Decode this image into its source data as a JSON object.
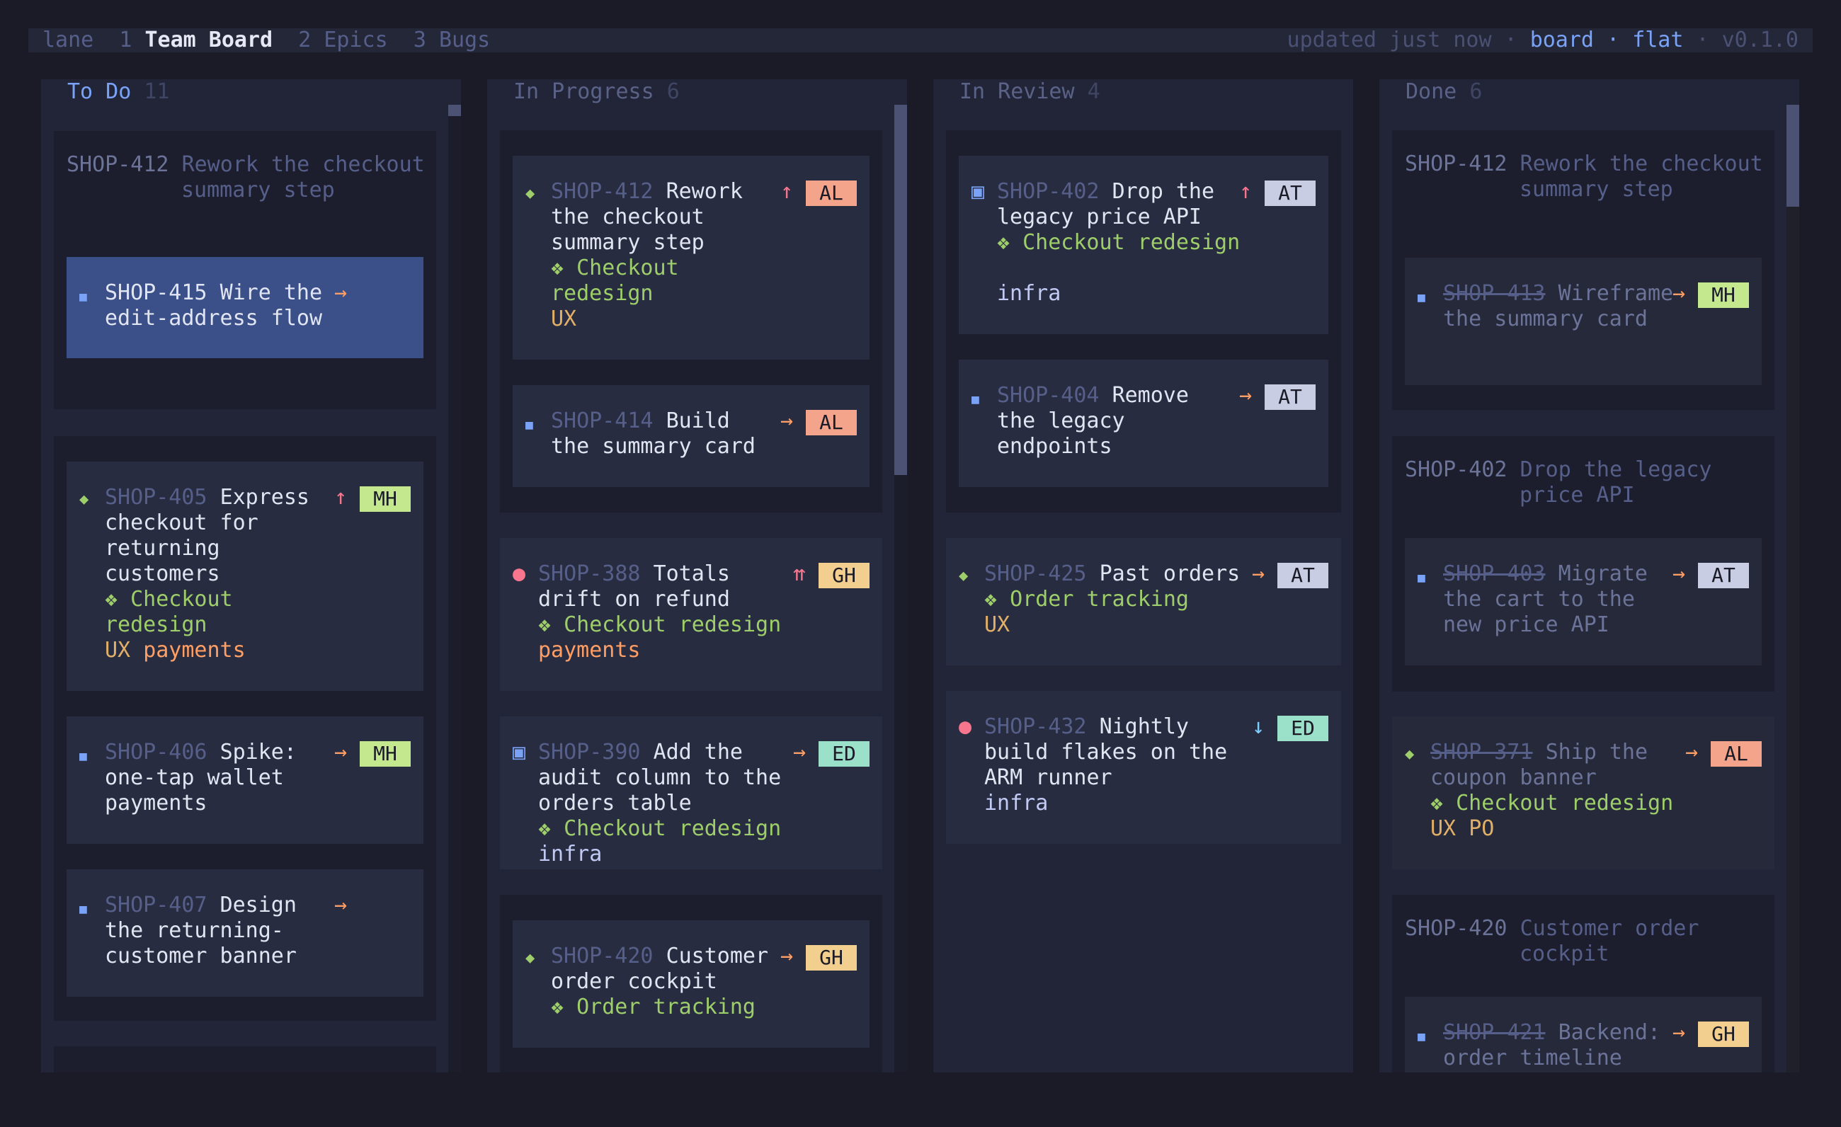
{
  "topbar": {
    "lane_label": "lane",
    "tabs": [
      {
        "num": "1",
        "label": "Team Board"
      },
      {
        "num": "2",
        "label": "Epics"
      },
      {
        "num": "3",
        "label": "Bugs"
      }
    ],
    "status": "updated just now",
    "sep": "·",
    "view": "board",
    "layout": "flat",
    "version": "v0.1.0"
  },
  "columns": {
    "todo": {
      "name": "To Do",
      "count": "11"
    },
    "inprogress": {
      "name": "In Progress",
      "count": "6"
    },
    "inreview": {
      "name": "In Review",
      "count": "4"
    },
    "done": {
      "name": "Done",
      "count": "6"
    }
  },
  "todo": {
    "group1": {
      "key": "SHOP-412",
      "line1": "Rework the checkout",
      "line2": "summary step"
    },
    "c415": {
      "key": "SHOP-415",
      "l1": "Wire the",
      "l2": "edit-address flow",
      "prio": "→"
    },
    "c405": {
      "key": "SHOP-405",
      "l1": "Express",
      "l2": "checkout for",
      "l3": "returning",
      "l4": "customers",
      "epic1": "❖ Checkout",
      "epic2": "redesign",
      "label1": "UX",
      "label2": "payments",
      "prio": "↑",
      "assignee": "MH"
    },
    "c406": {
      "key": "SHOP-406",
      "l1": "Spike:",
      "l2": "one-tap wallet",
      "l3": "payments",
      "prio": "→",
      "assignee": "MH"
    },
    "c407": {
      "key": "SHOP-407",
      "l1": "Design",
      "l2": "the returning-",
      "l3": "customer banner",
      "prio": "→"
    }
  },
  "inprogress": {
    "c412": {
      "key": "SHOP-412",
      "l1": "Rework",
      "l2": "the checkout",
      "l3": "summary step",
      "epic1": "❖ Checkout",
      "epic2": "redesign",
      "label": "UX",
      "prio": "↑",
      "assignee": "AL"
    },
    "c414": {
      "key": "SHOP-414",
      "l1": "Build",
      "l2": "the summary card",
      "prio": "→",
      "assignee": "AL"
    },
    "c388": {
      "key": "SHOP-388",
      "l1": "Totals",
      "l2": "drift on refund",
      "epic": "❖ Checkout redesign",
      "label": "payments",
      "prio": "⇈",
      "assignee": "GH"
    },
    "c390": {
      "key": "SHOP-390",
      "l1": "Add the",
      "l2": "audit column to the",
      "l3": "orders table",
      "epic": "❖ Checkout redesign",
      "label": "infra",
      "prio": "→",
      "assignee": "ED"
    },
    "c420": {
      "key": "SHOP-420",
      "l1": "Customer",
      "l2": "order cockpit",
      "epic": "❖ Order tracking",
      "prio": "→",
      "assignee": "GH"
    }
  },
  "inreview": {
    "c402": {
      "key": "SHOP-402",
      "l1": "Drop the",
      "l2": "legacy price API",
      "epic": "❖ Checkout redesign",
      "label": "infra",
      "prio": "↑",
      "assignee": "AT"
    },
    "c404": {
      "key": "SHOP-404",
      "l1": "Remove",
      "l2": "the legacy",
      "l3": "endpoints",
      "prio": "→",
      "assignee": "AT"
    },
    "c425": {
      "key": "SHOP-425",
      "l1": "Past orders",
      "epic": "❖ Order tracking",
      "label": "UX",
      "prio": "→",
      "assignee": "AT"
    },
    "c432": {
      "key": "SHOP-432",
      "l1": "Nightly",
      "l2": "build flakes on the",
      "l3": "ARM runner",
      "label": "infra",
      "prio": "↓",
      "assignee": "ED"
    }
  },
  "done": {
    "g412": {
      "key": "SHOP-412",
      "line1": "Rework the checkout",
      "line2": "summary step"
    },
    "c413": {
      "key": "SHOP-413",
      "l1": "Wireframe",
      "l2": "the summary card",
      "prio": "→",
      "assignee": "MH"
    },
    "g402": {
      "key": "SHOP-402",
      "line1": "Drop the legacy",
      "line2": "price API"
    },
    "c403": {
      "key": "SHOP-403",
      "l1": "Migrate",
      "l2": "the cart to the",
      "l3": "new price API",
      "prio": "→",
      "assignee": "AT"
    },
    "c371": {
      "key": "SHOP-371",
      "l1": "Ship the",
      "l2": "coupon banner",
      "epic": "❖ Checkout redesign",
      "label1": "UX",
      "label2": "PO",
      "prio": "→",
      "assignee": "AL"
    },
    "g420": {
      "key": "SHOP-420",
      "line1": "Customer order",
      "line2": "cockpit"
    },
    "c421": {
      "key": "SHOP-421",
      "l1": "Backend:",
      "l2": "order timeline",
      "prio": "→",
      "assignee": "GH"
    }
  },
  "icons": {
    "story": "■",
    "feature": "◆",
    "bug": "●",
    "task": "▣"
  },
  "colors": {
    "background": "#1a1b26",
    "panel": "#222538",
    "selected": "#3b5089",
    "accent": "#7aa2f7",
    "badge_AL": "#f4a48a",
    "badge_MH": "#c3e88d",
    "badge_GH": "#f2cf8e",
    "badge_ED": "#9be0c8",
    "badge_AT": "#c8cde3"
  }
}
